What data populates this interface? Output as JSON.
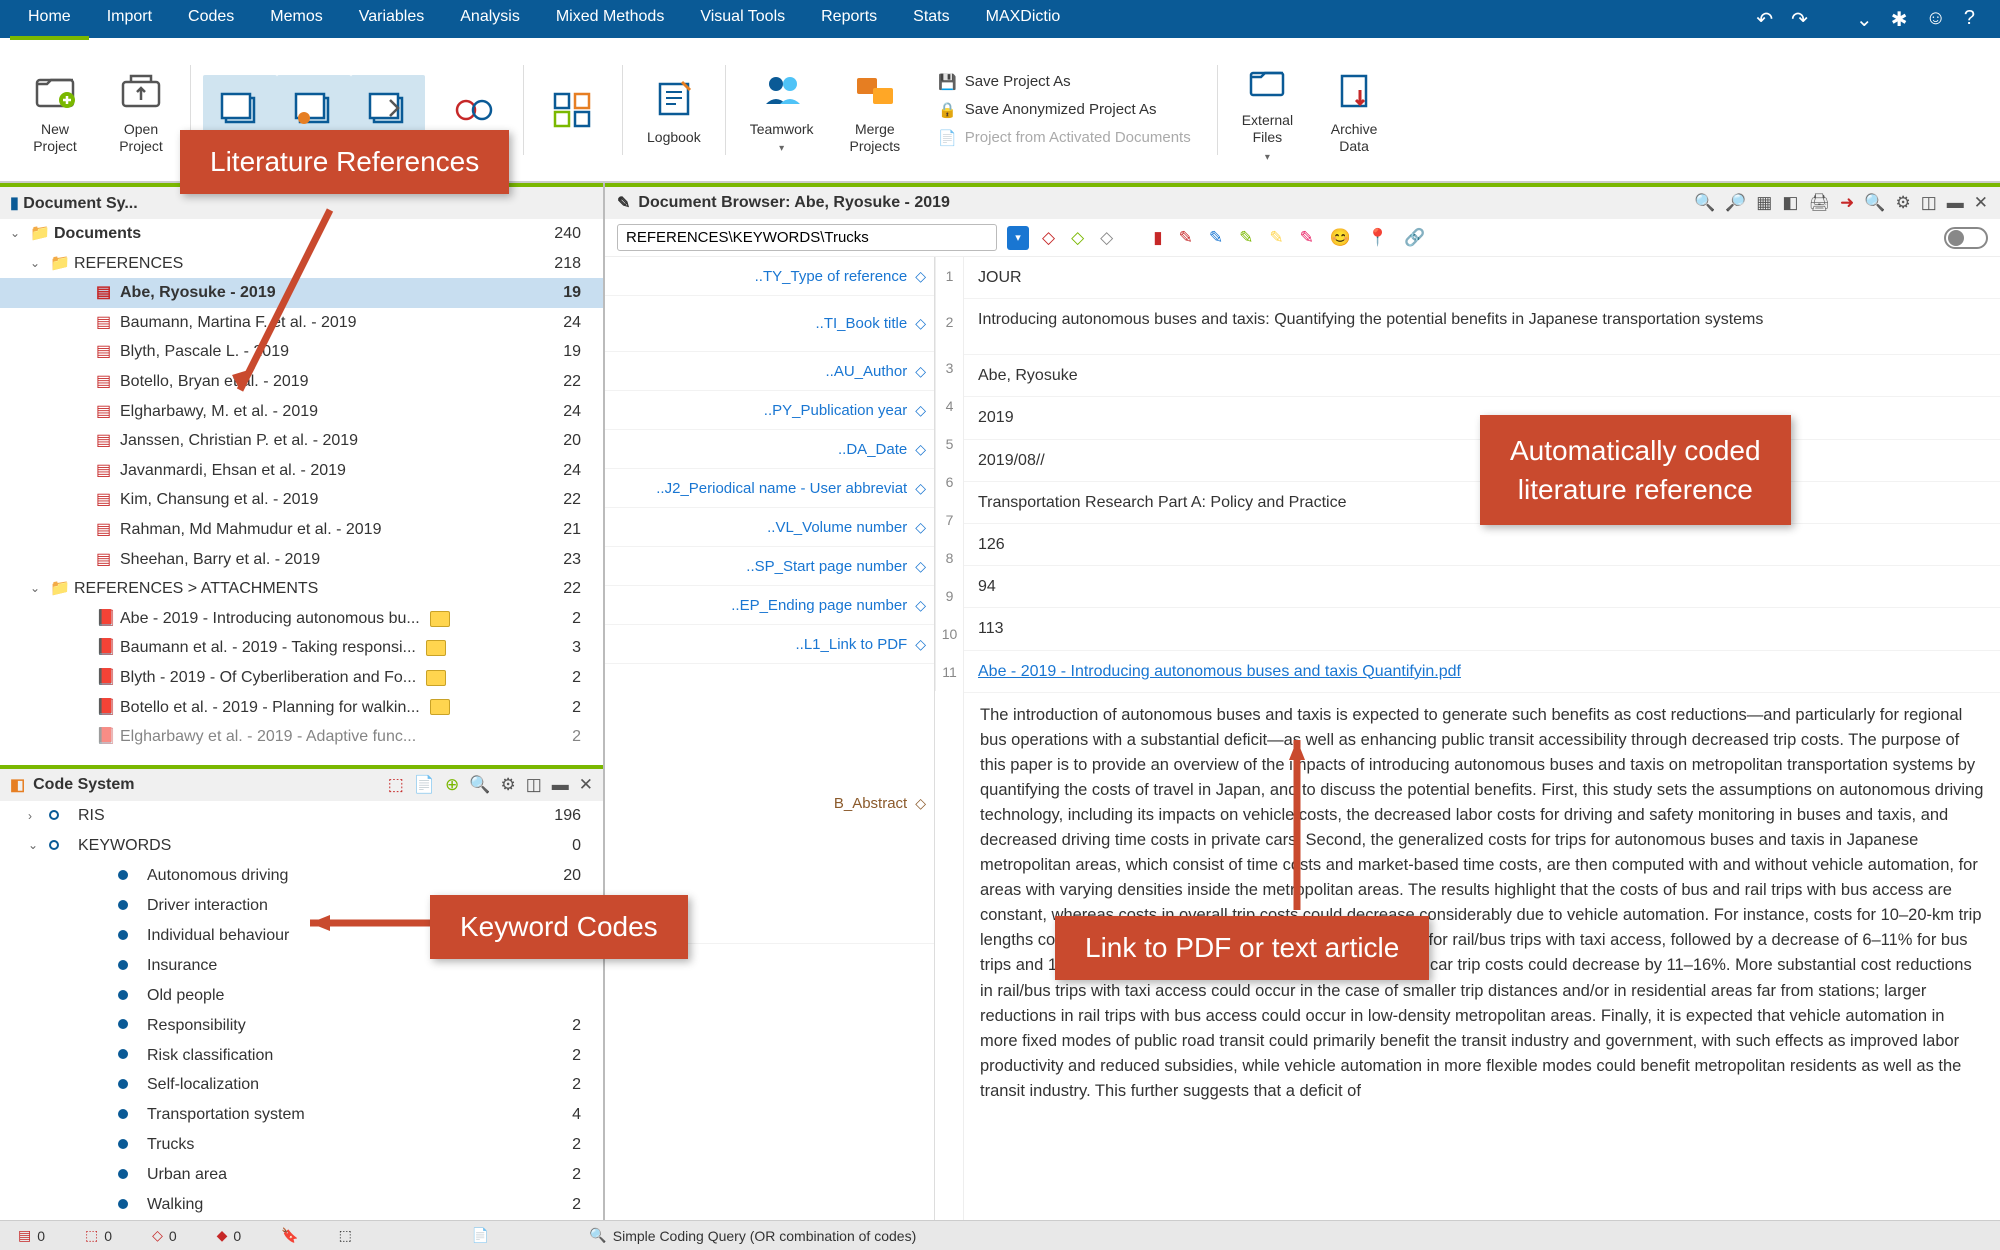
{
  "menubar": {
    "items": [
      "Home",
      "Import",
      "Codes",
      "Memos",
      "Variables",
      "Analysis",
      "Mixed Methods",
      "Visual Tools",
      "Reports",
      "Stats",
      "MAXDictio"
    ],
    "active": "Home"
  },
  "ribbon": {
    "new_project": "New\nProject",
    "open_project": "Open\nProject",
    "logbook": "Logbook",
    "teamwork": "Teamwork",
    "merge_projects": "Merge\nProjects",
    "save_as": "Save Project As",
    "save_anon": "Save Anonymized Project As",
    "project_from": "Project from Activated Documents",
    "external_files": "External\nFiles",
    "archive_data": "Archive\nData"
  },
  "doc_system": {
    "title": "Document Sy...",
    "root": {
      "label": "Documents",
      "count": 240
    },
    "folders": [
      {
        "label": "REFERENCES",
        "count": 218
      }
    ],
    "refs": [
      {
        "label": "Abe, Ryosuke - 2019",
        "count": 19,
        "selected": true
      },
      {
        "label": "Baumann, Martina F. et al. - 2019",
        "count": 24
      },
      {
        "label": "Blyth, Pascale L. - 2019",
        "count": 19
      },
      {
        "label": "Botello, Bryan et al. - 2019",
        "count": 22
      },
      {
        "label": "Elgharbawy, M. et al. - 2019",
        "count": 24
      },
      {
        "label": "Janssen, Christian P. et al. - 2019",
        "count": 20
      },
      {
        "label": "Javanmardi, Ehsan et al. - 2019",
        "count": 24
      },
      {
        "label": "Kim, Chansung et al. - 2019",
        "count": 22
      },
      {
        "label": "Rahman, Md Mahmudur et al. - 2019",
        "count": 21
      },
      {
        "label": "Sheehan, Barry et al. - 2019",
        "count": 23
      }
    ],
    "attachments_folder": {
      "label": "REFERENCES > ATTACHMENTS",
      "count": 22
    },
    "attachments": [
      {
        "label": "Abe - 2019 - Introducing autonomous bu...",
        "count": 2,
        "memo": true
      },
      {
        "label": "Baumann et al. - 2019 - Taking responsi...",
        "count": 3,
        "memo": true
      },
      {
        "label": "Blyth - 2019 - Of Cyberliberation and Fo...",
        "count": 2,
        "memo": true
      },
      {
        "label": "Botello et al. - 2019 - Planning for walkin...",
        "count": 2,
        "memo": true
      },
      {
        "label": "Elgharbawy et al. - 2019 - Adaptive func...",
        "count": 2,
        "memo": true
      }
    ]
  },
  "code_system": {
    "title": "Code System",
    "groups": [
      {
        "label": "RIS",
        "count": 196,
        "expandable": true,
        "expanded": false
      },
      {
        "label": "KEYWORDS",
        "count": 0,
        "expandable": true,
        "expanded": true
      }
    ],
    "keywords": [
      {
        "label": "Autonomous driving",
        "count": 20
      },
      {
        "label": "Driver interaction",
        "count": ""
      },
      {
        "label": "Individual behaviour",
        "count": ""
      },
      {
        "label": "Insurance",
        "count": ""
      },
      {
        "label": "Old people",
        "count": ""
      },
      {
        "label": "Responsibility",
        "count": 2
      },
      {
        "label": "Risk classification",
        "count": 2
      },
      {
        "label": "Self-localization",
        "count": 2
      },
      {
        "label": "Transportation system",
        "count": 4
      },
      {
        "label": "Trucks",
        "count": 2
      },
      {
        "label": "Urban area",
        "count": 2
      },
      {
        "label": "Walking",
        "count": 2
      }
    ]
  },
  "browser": {
    "title": "Document Browser: Abe, Ryosuke - 2019",
    "path": "REFERENCES\\KEYWORDS\\Trucks",
    "fields": [
      {
        "code": "..TY_Type of reference",
        "num": 1,
        "val": "JOUR"
      },
      {
        "code": "..TI_Book title",
        "num": 2,
        "val": "Introducing autonomous buses and taxis: Quantifying the potential benefits in Japanese transportation systems"
      },
      {
        "code": "..AU_Author",
        "num": 3,
        "val": "Abe, Ryosuke"
      },
      {
        "code": "..PY_Publication year",
        "num": 4,
        "val": "2019"
      },
      {
        "code": "..DA_Date",
        "num": 5,
        "val": "2019/08//"
      },
      {
        "code": "..J2_Periodical name - User abbreviat",
        "num": 6,
        "val": "Transportation Research Part A: Policy and Practice"
      },
      {
        "code": "..VL_Volume number",
        "num": 7,
        "val": "126"
      },
      {
        "code": "..SP_Start page number",
        "num": 8,
        "val": "94"
      },
      {
        "code": "..EP_Ending page number",
        "num": 9,
        "val": "113"
      },
      {
        "code": "..L1_Link to PDF",
        "num": 10,
        "val": "Abe - 2019 - Introducing autonomous buses and taxis Quantifyin.pdf",
        "link": true
      }
    ],
    "abstract_code": "B_Abstract",
    "abstract_num": 11,
    "abstract": "The introduction of autonomous buses and taxis is expected to generate such benefits as cost reductions—and particularly for regional bus operations with a substantial deficit—as well as enhancing public transit accessibility through decreased trip costs. The purpose of this paper is to provide an overview of the impacts of introducing autonomous buses and taxis on metropolitan transportation systems by quantifying the costs of travel in Japan, and to discuss the potential benefits. First, this study sets the assumptions on autonomous driving technology, including its impacts on vehicle costs, the decreased labor costs for driving and safety monitoring in buses and taxis, and decreased driving time costs in private cars. Second, the generalized costs for trips for autonomous buses and taxis in Japanese metropolitan areas, which consist of time costs and market-based time costs, are then computed with and without vehicle automation, for areas with varying densities inside the metropolitan areas. The results highlight that the costs of bus and rail trips with bus access are constant, whereas costs in overall trip costs could decrease considerably due to vehicle automation. For instance, costs for 10–20-km trip lengths could decrease by 44–61% for taxi trips and 13–37% for rail/bus trips with taxi access, followed by a decrease of 6–11% for bus trips and 1–11% for rail trips with bus access. Further, private car trip costs could decrease by 11–16%. More substantial cost reductions in rail/bus trips with taxi access could occur in the case of smaller trip distances and/or in residential areas far from stations; larger reductions in rail trips with bus access could occur in low-density metropolitan areas. Finally, it is expected that vehicle automation in more fixed modes of public road transit could primarily benefit the transit industry and government, with such effects as improved labor productivity and reduced subsidies, while vehicle automation in more flexible modes could benefit metropolitan residents as well as the transit industry. This further suggests that a deficit of"
  },
  "callouts": {
    "lit_ref": "Literature References",
    "keyword_codes": "Keyword Codes",
    "auto_coded": "Automatically coded\nliterature reference",
    "link_pdf": "Link to PDF or text article"
  },
  "statusbar": {
    "query": "Simple Coding Query (OR combination of codes)",
    "zeros": [
      "0",
      "0",
      "0",
      "0"
    ]
  }
}
